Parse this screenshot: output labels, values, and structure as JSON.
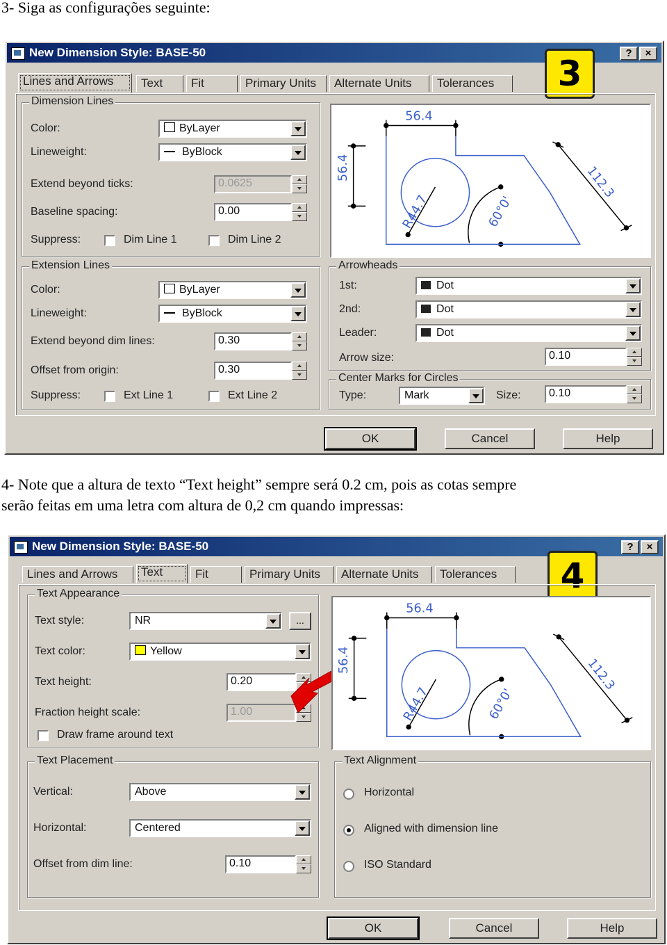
{
  "doc": {
    "heading3": "3- Siga as configurações seguinte:",
    "note4_line1": "4- Note que a altura de texto “Text height” sempre será 0.2 cm, pois as cotas sempre",
    "note4_line2": "serão feitas em uma letra com altura de 0,2 cm quando impressas:"
  },
  "colors": {
    "titlebar": "#0a246a",
    "dialog_bg": "#d4d0c8",
    "badge": "#ffe800",
    "dim_preview": "#3a5fcd",
    "yellow": "#ffff00",
    "arrow": "#e00000"
  },
  "dialog1": {
    "title": "New Dimension Style: BASE-50",
    "help_glyph": "?",
    "close_glyph": "×",
    "badge": "3",
    "tabs": [
      "Lines and Arrows",
      "Text",
      "Fit",
      "Primary Units",
      "Alternate Units",
      "Tolerances"
    ],
    "dim_lines": {
      "title": "Dimension Lines",
      "color_label": "Color:",
      "color_value": "ByLayer",
      "lineweight_label": "Lineweight:",
      "lineweight_value": "ByBlock",
      "extend_ticks_label": "Extend beyond ticks:",
      "extend_ticks_value": "0.0625",
      "baseline_label": "Baseline spacing:",
      "baseline_value": "0.00",
      "suppress_label": "Suppress:",
      "dim_line_1": "Dim Line 1",
      "dim_line_2": "Dim Line 2"
    },
    "ext_lines": {
      "title": "Extension Lines",
      "color_label": "Color:",
      "color_value": "ByLayer",
      "lineweight_label": "Lineweight:",
      "lineweight_value": "ByBlock",
      "extend_label": "Extend beyond dim lines:",
      "extend_value": "0.30",
      "offset_label": "Offset from origin:",
      "offset_value": "0.30",
      "suppress_label": "Suppress:",
      "ext_line_1": "Ext Line 1",
      "ext_line_2": "Ext Line 2"
    },
    "arrowheads": {
      "title": "Arrowheads",
      "first_label": "1st:",
      "first_value": "Dot",
      "second_label": "2nd:",
      "second_value": "Dot",
      "leader_label": "Leader:",
      "leader_value": "Dot",
      "size_label": "Arrow size:",
      "size_value": "0.10"
    },
    "center_marks": {
      "title": "Center Marks for Circles",
      "type_label": "Type:",
      "type_value": "Mark",
      "size_label": "Size:",
      "size_value": "0.10"
    },
    "buttons": {
      "ok": "OK",
      "cancel": "Cancel",
      "help": "Help"
    }
  },
  "dialog2": {
    "title": "New Dimension Style: BASE-50",
    "help_glyph": "?",
    "close_glyph": "×",
    "badge": "4",
    "tabs": [
      "Lines and Arrows",
      "Text",
      "Fit",
      "Primary Units",
      "Alternate Units",
      "Tolerances"
    ],
    "text_appearance": {
      "title": "Text Appearance",
      "style_label": "Text style:",
      "style_value": "NR",
      "browse": "...",
      "color_label": "Text color:",
      "color_value": "Yellow",
      "height_label": "Text height:",
      "height_value": "0.20",
      "fraction_label": "Fraction height scale:",
      "fraction_value": "1.00",
      "frame_label": "Draw frame around text"
    },
    "text_placement": {
      "title": "Text Placement",
      "vertical_label": "Vertical:",
      "vertical_value": "Above",
      "horizontal_label": "Horizontal:",
      "horizontal_value": "Centered",
      "offset_label": "Offset from dim line:",
      "offset_value": "0.10"
    },
    "text_alignment": {
      "title": "Text Alignment",
      "options": [
        "Horizontal",
        "Aligned with dimension line",
        "ISO Standard"
      ],
      "selected": "Aligned with dimension line"
    },
    "buttons": {
      "ok": "OK",
      "cancel": "Cancel",
      "help": "Help"
    }
  },
  "preview": {
    "dim_top": "56.4",
    "dim_left": "56.4",
    "dim_diag": "112.3",
    "radius": "R44.7",
    "angle": "60°0'"
  }
}
